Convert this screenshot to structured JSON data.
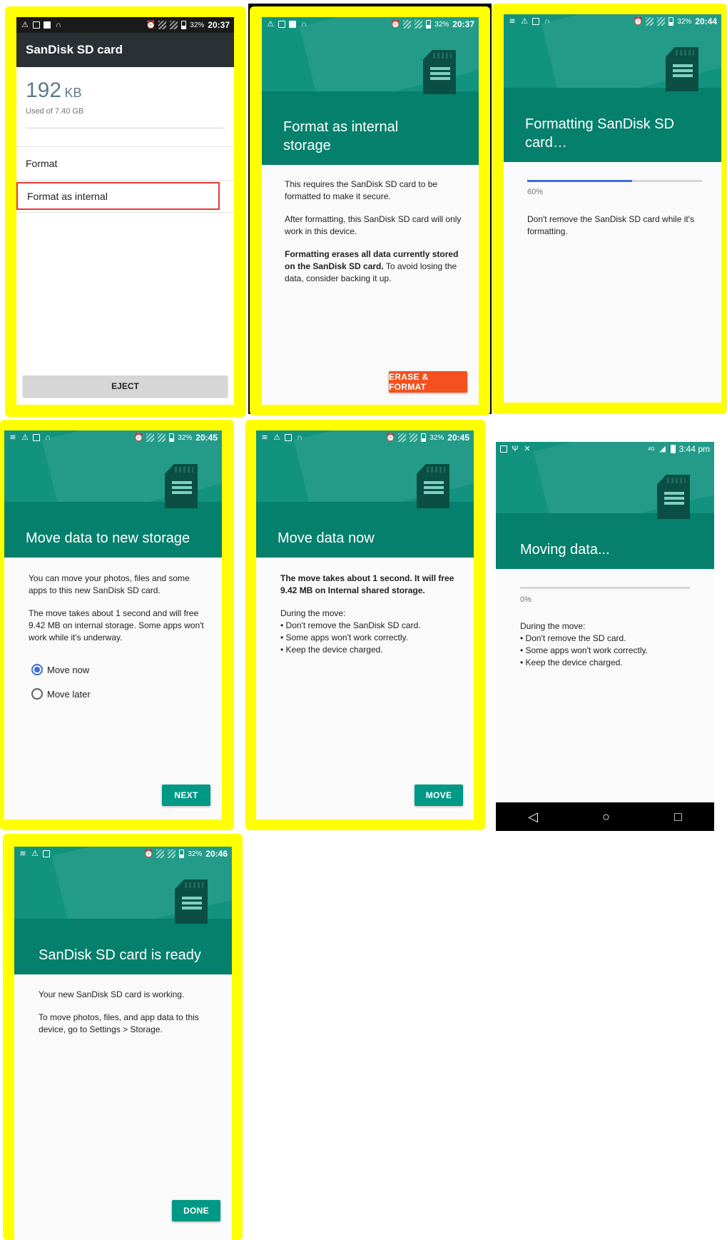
{
  "screens": {
    "s1": {
      "status": {
        "time": "20:37",
        "battery": "32%"
      },
      "toolbar_title": "SanDisk SD card",
      "used_number": "192",
      "used_unit": "KB",
      "used_of": "Used of 7.40 GB",
      "menu": [
        "Format",
        "Format as internal"
      ],
      "eject_label": "EJECT"
    },
    "s2": {
      "status": {
        "time": "20:37",
        "battery": "32%"
      },
      "title": "Format as internal storage",
      "p1": "This requires the SanDisk SD card to be formatted to make it secure.",
      "p2": "After formatting, this SanDisk SD card will only work in this device.",
      "p3_bold": "Formatting erases all data currently stored on the SanDisk SD card.",
      "p3_rest": " To avoid losing the data, consider backing it up.",
      "button": "ERASE & FORMAT"
    },
    "s3": {
      "status": {
        "time": "20:44",
        "battery": "32%"
      },
      "title": "Formatting SanDisk SD card…",
      "progress": 0.6,
      "progress_label": "60%",
      "note": "Don't remove the SanDisk SD card while it's formatting."
    },
    "s4": {
      "status": {
        "time": "20:45",
        "battery": "32%"
      },
      "title": "Move data to new storage",
      "p1": "You can move your photos, files and some apps to this new SanDisk SD card.",
      "p2": "The move takes about 1 second and will free 9.42 MB on internal storage. Some apps won't work while it's underway.",
      "options": [
        "Move now",
        "Move later"
      ],
      "button": "NEXT"
    },
    "s5": {
      "status": {
        "time": "20:45",
        "battery": "32%"
      },
      "title": "Move data now",
      "p1_bold": "The move takes about 1 second. It will free 9.42 MB on Internal shared storage.",
      "during": "During the move:",
      "bullets": [
        "• Don't remove the SanDisk SD card.",
        "• Some apps won't work correctly.",
        "• Keep the device charged."
      ],
      "button": "MOVE"
    },
    "s6": {
      "status": {
        "time": "3:44 pm",
        "network": "4G"
      },
      "title": "Moving data...",
      "progress": 0.0,
      "progress_label": "0%",
      "during": "During the move:",
      "bullets": [
        "• Don't remove the SD card.",
        "• Some apps won't work correctly.",
        "• Keep the device charged."
      ],
      "nav": [
        "back-icon",
        "home-icon",
        "recents-icon"
      ]
    },
    "s7": {
      "status": {
        "time": "20:46",
        "battery": "32%"
      },
      "title": "SanDisk SD card is ready",
      "p1": "Your new SanDisk SD card is working.",
      "p2": "To move photos, files, and app data to this device, go to Settings > Storage.",
      "button": "DONE"
    }
  },
  "colors": {
    "highlight": "#ffff00",
    "teal": "#05806c",
    "teal_light": "#12937f",
    "accent": "#009985",
    "orange": "#f4511e",
    "progress": "#3b6fd6",
    "selection_box": "#e53935"
  }
}
